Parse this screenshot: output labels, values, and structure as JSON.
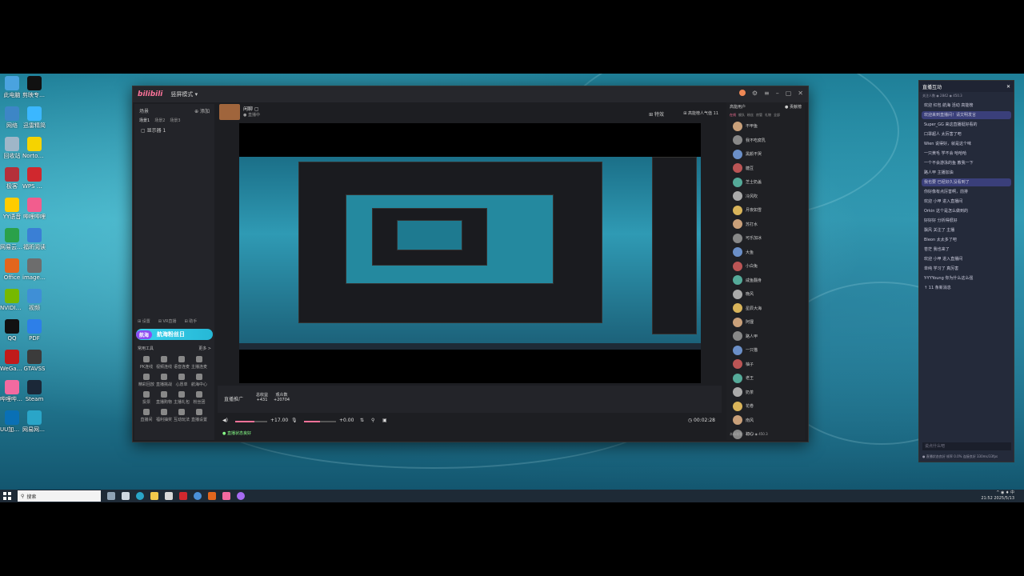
{
  "desktop": {
    "icons": [
      {
        "label": "此电脑",
        "color": "#4aa3df"
      },
      {
        "label": "剪映专业版",
        "color": "#111111"
      },
      {
        "label": "网络",
        "color": "#3d86c6"
      },
      {
        "label": "迅雷精简",
        "color": "#3bb7ff"
      },
      {
        "label": "回收站",
        "color": "#9fb6c8"
      },
      {
        "label": "Norton 360 for Gamers",
        "color": "#f5d300"
      },
      {
        "label": "极客",
        "color": "#b5303a"
      },
      {
        "label": "WPS Office",
        "color": "#d0282e"
      },
      {
        "label": "YY语音",
        "color": "#ffcc00"
      },
      {
        "label": "哔哩哔哩",
        "color": "#f25d8e"
      },
      {
        "label": "网易云音乐",
        "color": "#2aa14a"
      },
      {
        "label": "福昕阅读",
        "color": "#3a7fd5"
      },
      {
        "label": "Office",
        "color": "#e2661d"
      },
      {
        "label": "image_01",
        "color": "#6d6d6d"
      },
      {
        "label": "NVIDIA App",
        "color": "#76b900"
      },
      {
        "label": "视频",
        "color": "#3f8fd6"
      },
      {
        "label": "QQ",
        "color": "#111111"
      },
      {
        "label": "PDF",
        "color": "#2d7fe8"
      },
      {
        "label": "WeGame",
        "color": "#c01b1b"
      },
      {
        "label": "GTAVSS",
        "color": "#3b3b3b"
      },
      {
        "label": "哔哩哔哩直播姬",
        "color": "#f36aa0"
      },
      {
        "label": "Steam",
        "color": "#1b2838"
      },
      {
        "label": "UU加速器",
        "color": "#0a70b5"
      },
      {
        "label": "网易网上邻居",
        "color": "#2aa5c8"
      }
    ]
  },
  "live_window": {
    "title_logo": "bilibili",
    "mode": "竖屏模式 ▾",
    "left": {
      "scene_header": "场景",
      "add_scene": "⊕ 添加",
      "tabs": [
        "场景1",
        "场景2",
        "场景3"
      ],
      "scene_item": "▢ 显示器 1",
      "bottom_actions": [
        "⊞ 设置",
        "⊞ VR直播",
        "⊞ 助手"
      ],
      "banner_tag": "航海",
      "banner_text": "航海粉丝日",
      "tools_header": "常用工具",
      "tools_more": "更多 >",
      "tools": [
        "PK连线",
        "视频连线",
        "语音连麦",
        "主播连麦",
        "精彩回放",
        "直播挑战",
        "心愿单",
        "航海中心",
        "投票",
        "直播购物",
        "主播礼包",
        "粉丝团",
        "直播间",
        "福利抽奖",
        "互动玩法",
        "直播设置"
      ]
    },
    "topbar": {
      "room_title": "闲聊 ▢",
      "room_sub": "● 直播中",
      "right_a": "⊞ 特效",
      "right_b": "⊞ 高能榜人气值 11"
    },
    "bottom": {
      "promo": "直播推广",
      "stat1_label": "总收益",
      "stat1_value": "+431",
      "stat2_label": "观众数",
      "stat2_value": "+20704"
    },
    "controls": {
      "mic_level": "+17.00",
      "desktop_level": "+0.00",
      "timer": "◷ 00:02:28"
    },
    "status": "● 直播状态良好",
    "right": {
      "header": "高能用户",
      "header_count": "● 贡献榜",
      "tabs": [
        "在线",
        "舰队",
        "粉丝",
        "房管",
        "礼物",
        "全部"
      ],
      "users": [
        "不甲鱼",
        "我不吃腐乳",
        "黑颜不哭",
        "糖豆",
        "芝士奶盖",
        "冷风吹",
        "月夜如雪",
        "苏打水",
        "可乐加冰",
        "大鱼",
        "小白兔",
        "咸鱼翻身",
        "晚风",
        "星辰大海",
        "阿狸",
        "路人甲",
        "一只猫",
        "柚子",
        "老王",
        "奶茶",
        "花卷",
        "南风",
        "初心"
      ],
      "footer": "本场观看：2842  ◉ 450.3"
    }
  },
  "chat": {
    "title": "直播互动",
    "sub": "关注人数 ◉ 2842  ◉ 450.3",
    "messages": [
      {
        "text": "欢迎 红包 航海 活动 高能榜",
        "hl": false
      },
      {
        "text": "欢迎来到直播间！请文明发言",
        "hl": true
      },
      {
        "text": "Super_GG 来这直播挺好看的",
        "hl": false
      },
      {
        "text": "口罩超人 太厉害了吧",
        "hl": false
      },
      {
        "text": "Wien 说得好，就是这个味",
        "hl": false
      },
      {
        "text": "一只黄毛 学不会 哈哈哈",
        "hl": false
      },
      {
        "text": "一个不会游泳的鱼 教我一下",
        "hl": false
      },
      {
        "text": "路人甲 主播加油",
        "hl": false
      },
      {
        "text": "我也要 已经好久没看到了",
        "hl": true
      },
      {
        "text": "你好像有点厉害啊，前排",
        "hl": false
      },
      {
        "text": "欢迎 小甲 进入直播间",
        "hl": false
      },
      {
        "text": "Orkin 这个是怎么做到的",
        "hl": false
      },
      {
        "text": "好好好 分析得很好",
        "hl": false
      },
      {
        "text": "飘风 关注了 主播",
        "hl": false
      },
      {
        "text": "Bleon 太太多了吧",
        "hl": false
      },
      {
        "text": "苍茫 我也来了",
        "hl": false
      },
      {
        "text": "欢迎 小甲 进入直播间",
        "hl": false
      },
      {
        "text": "单纯 学习了 真厉害",
        "hl": false
      },
      {
        "text": "Y-YYYoung 你为什么这么强",
        "hl": false
      },
      {
        "text": "↑ 11 条新消息",
        "hl": false
      }
    ],
    "input_placeholder": "说点什么吧",
    "footer": "● 直播状态良好  帧率 0.0%  连接良好 330ms/33fps"
  },
  "taskbar": {
    "search": "搜索",
    "time": "21:52",
    "date": "2025/5/13",
    "tray_text": "^ ◉ ♦ 中"
  }
}
